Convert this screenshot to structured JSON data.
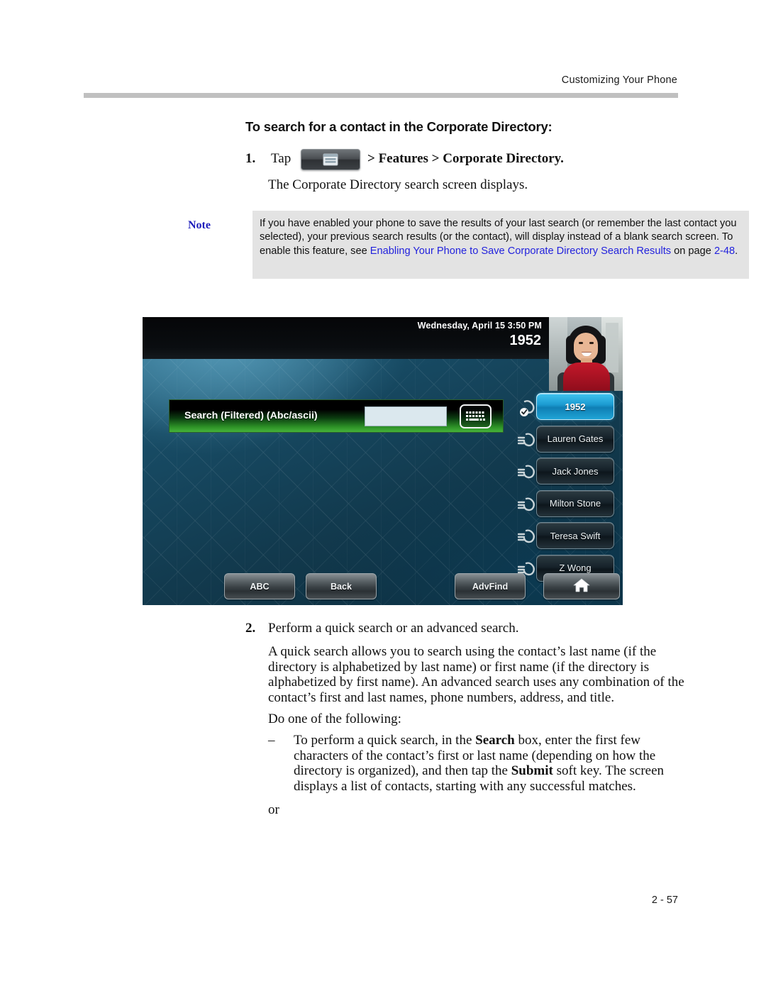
{
  "header": {
    "running_head": "Customizing Your Phone"
  },
  "section": {
    "title": "To search for a contact in the Corporate Directory:"
  },
  "steps": {
    "one": {
      "number": "1.",
      "tap_label": "Tap",
      "menu_icon": "menu-button-icon",
      "path_text": "> Features > Corporate Directory.",
      "result_text": "The Corporate Directory search screen displays."
    },
    "two": {
      "number": "2.",
      "text": "Perform a quick search or an advanced search.",
      "paragraph": "A quick search allows you to search using the contact’s last name (if the directory is alphabetized by last name) or first name (if the directory is alphabetized by first name). An advanced search uses any combination of the contact’s first and last names, phone numbers, address, and title.",
      "do_one": "Do one of the following:",
      "bullet_dash": "–",
      "bullet_text_1": "To perform a quick search, in the ",
      "bullet_bold_1": "Search",
      "bullet_text_2": " box, enter the first few characters of the contact’s first or last name (depending on how the directory is organized), and then tap the ",
      "bullet_bold_2": "Submit",
      "bullet_text_3": " soft key. The screen displays a list of contacts, starting with any successful matches.",
      "or": "or"
    }
  },
  "note": {
    "label": "Note",
    "text_1": "If you have enabled your phone to save the results of your last search (or remember the last contact you selected), your previous search results (or the contact), will display instead of a blank search screen. To enable this feature, see ",
    "link": "Enabling Your Phone to Save Corporate Directory Search Results",
    "text_2": " on page ",
    "page_ref": "2-48",
    "text_3": "."
  },
  "phone_screen": {
    "status": {
      "datetime": "Wednesday, April 15  3:50 PM",
      "extension": "1952"
    },
    "search": {
      "label": "Search (Filtered) (Abc/ascii)",
      "value": "",
      "keyboard_icon": "keyboard-icon"
    },
    "contacts": [
      {
        "label": "1952",
        "active": true,
        "icon": "handset-registered-icon"
      },
      {
        "label": "Lauren Gates",
        "active": false,
        "icon": "handset-line-icon"
      },
      {
        "label": "Jack Jones",
        "active": false,
        "icon": "handset-line-icon"
      },
      {
        "label": "Milton Stone",
        "active": false,
        "icon": "handset-line-icon"
      },
      {
        "label": "Teresa Swift",
        "active": false,
        "icon": "handset-line-icon"
      },
      {
        "label": "Z Wong",
        "active": false,
        "icon": "handset-line-icon"
      }
    ],
    "softkeys": [
      {
        "label": "ABC"
      },
      {
        "label": "Back"
      },
      {
        "label": "AdvFind"
      },
      {
        "label": "",
        "icon": "home-icon"
      }
    ]
  },
  "footer": {
    "page_number": "2 - 57"
  },
  "colors": {
    "link": "#2222dd",
    "note_bg": "#e3e3e3",
    "rule": "#c0c0c0",
    "accent_blue": "#1c9cd2",
    "search_green": "#46b33a"
  }
}
